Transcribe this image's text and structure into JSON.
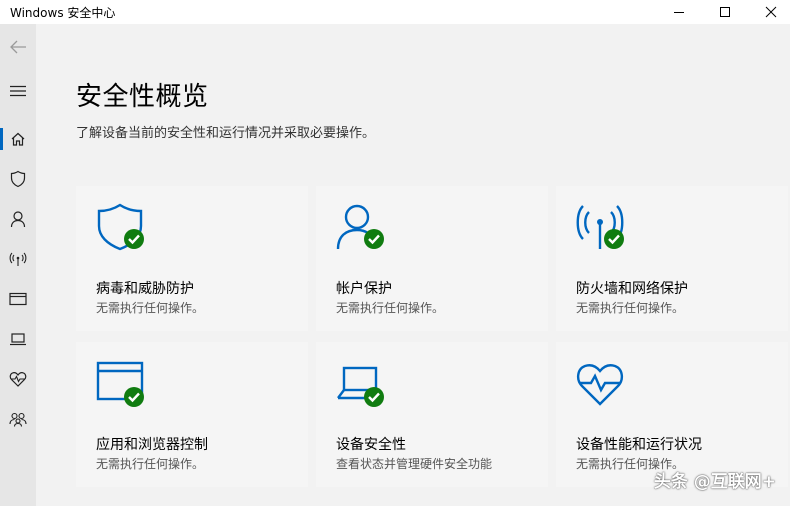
{
  "window": {
    "title": "Windows 安全中心"
  },
  "page": {
    "title": "安全性概览",
    "subtitle": "了解设备当前的安全性和运行情况并采取必要操作。"
  },
  "cards": [
    {
      "icon": "shield-icon",
      "title": "病毒和威胁防护",
      "desc": "无需执行任何操作。"
    },
    {
      "icon": "person-icon",
      "title": "帐户保护",
      "desc": "无需执行任何操作。"
    },
    {
      "icon": "antenna-icon",
      "title": "防火墙和网络保护",
      "desc": "无需执行任何操作。"
    },
    {
      "icon": "browser-window-icon",
      "title": "应用和浏览器控制",
      "desc": "无需执行任何操作。"
    },
    {
      "icon": "laptop-icon",
      "title": "设备安全性",
      "desc": "查看状态并管理硬件安全功能"
    },
    {
      "icon": "heart-pulse-icon",
      "title": "设备性能和运行状况",
      "desc": "无需执行任何操作。"
    }
  ],
  "colors": {
    "accent": "#0067c0",
    "ok_green": "#107c10"
  },
  "watermark": "头条 @互联网+"
}
